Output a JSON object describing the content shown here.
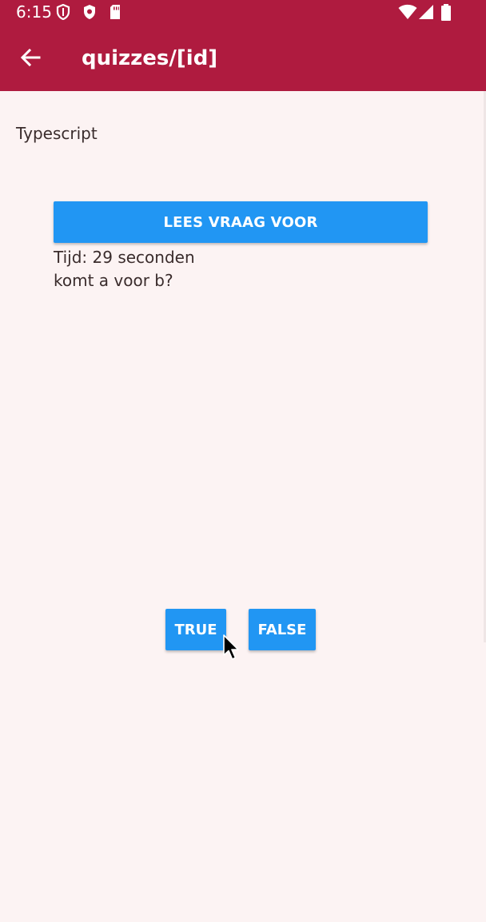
{
  "status_bar": {
    "time": "6:15",
    "icons": [
      "shield-icon",
      "security-icon",
      "sd-card-icon",
      "wifi-icon",
      "cell-signal-icon",
      "battery-icon"
    ]
  },
  "app_bar": {
    "back_icon": "arrow-left-icon",
    "title": "quizzes/[id]",
    "color": "#af1b3f"
  },
  "quiz": {
    "topic": "Typescript",
    "read_button_label": "LEES VRAAG VOOR",
    "timer_text": "Tijd: 29 seconden",
    "question_text": "komt a voor b?",
    "true_label": "TRUE",
    "false_label": "FALSE",
    "button_color": "#2196f3"
  },
  "background_color": "#fcf3f3"
}
